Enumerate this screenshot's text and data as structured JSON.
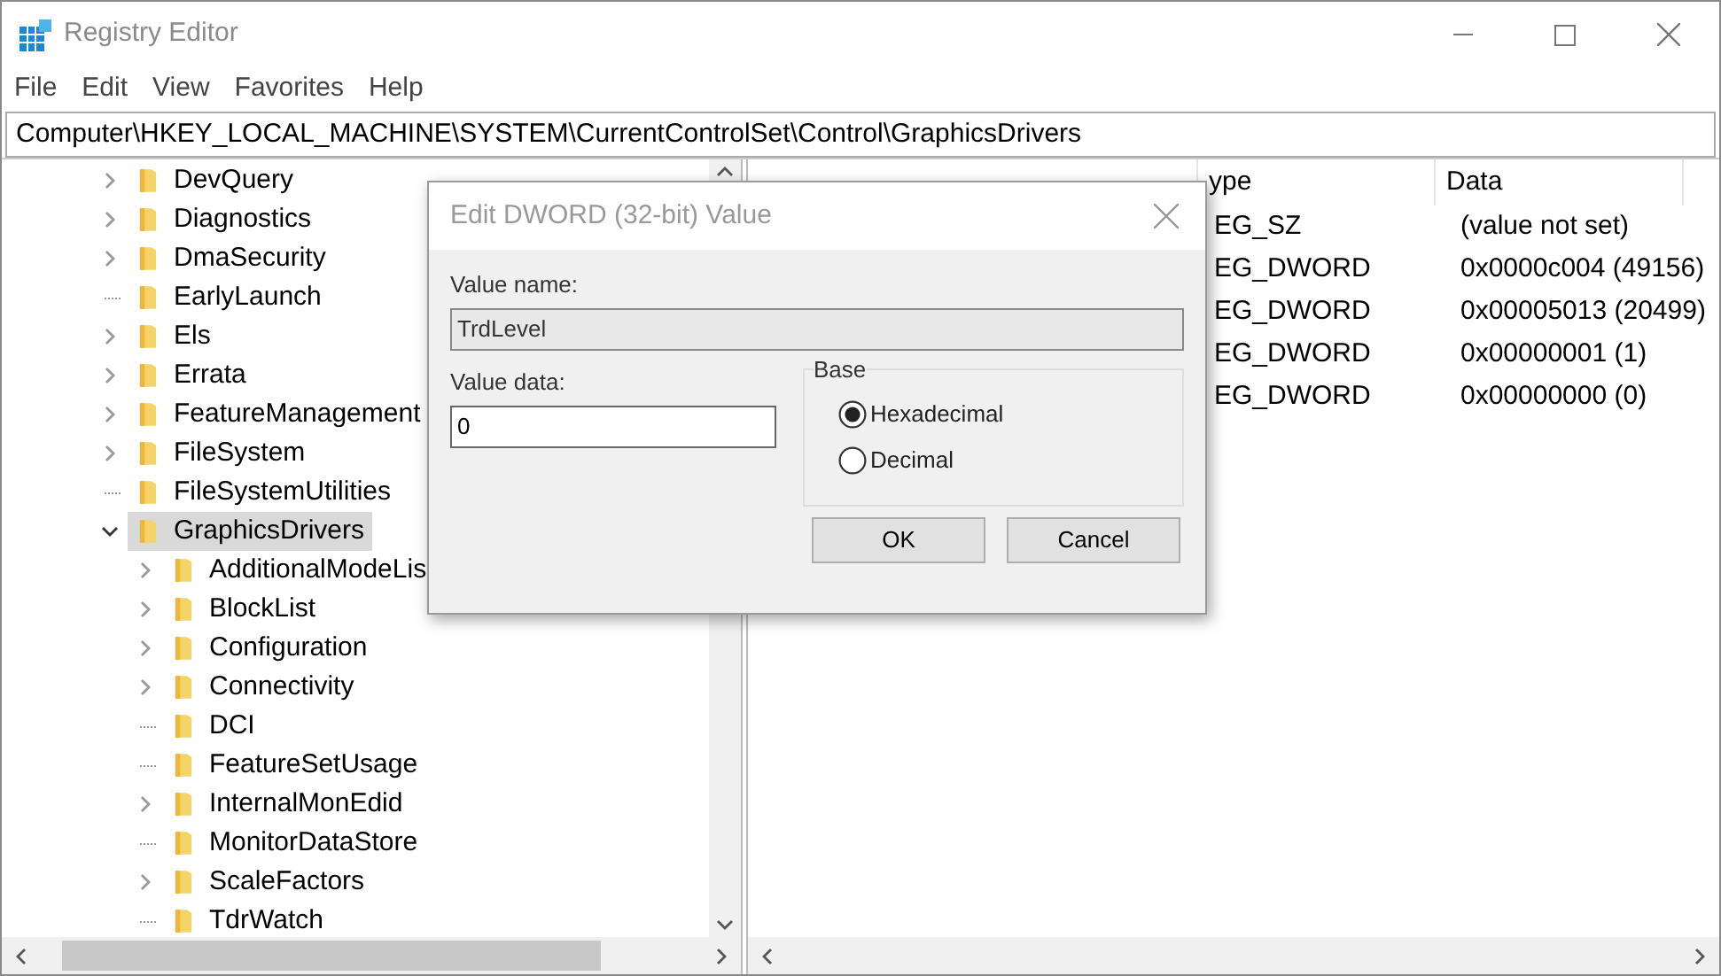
{
  "window": {
    "title": "Registry Editor"
  },
  "menu": [
    "File",
    "Edit",
    "View",
    "Favorites",
    "Help"
  ],
  "address": "Computer\\HKEY_LOCAL_MACHINE\\SYSTEM\\CurrentControlSet\\Control\\GraphicsDrivers",
  "tree": [
    {
      "label": "DevQuery",
      "kind": "collapsed",
      "selected": false
    },
    {
      "label": "Diagnostics",
      "kind": "collapsed",
      "selected": false
    },
    {
      "label": "DmaSecurity",
      "kind": "collapsed",
      "selected": false
    },
    {
      "label": "EarlyLaunch",
      "kind": "leaf",
      "selected": false
    },
    {
      "label": "Els",
      "kind": "collapsed",
      "selected": false
    },
    {
      "label": "Errata",
      "kind": "collapsed",
      "selected": false
    },
    {
      "label": "FeatureManagement",
      "kind": "collapsed",
      "selected": false
    },
    {
      "label": "FileSystem",
      "kind": "collapsed",
      "selected": false
    },
    {
      "label": "FileSystemUtilities",
      "kind": "leaf",
      "selected": false
    },
    {
      "label": "GraphicsDrivers",
      "kind": "expanded",
      "selected": true,
      "children": [
        {
          "label": "AdditionalModeLis",
          "kind": "collapsed",
          "selected": false
        },
        {
          "label": "BlockList",
          "kind": "collapsed",
          "selected": false
        },
        {
          "label": "Configuration",
          "kind": "collapsed",
          "selected": false
        },
        {
          "label": "Connectivity",
          "kind": "collapsed",
          "selected": false
        },
        {
          "label": "DCI",
          "kind": "leaf",
          "selected": false
        },
        {
          "label": "FeatureSetUsage",
          "kind": "leaf",
          "selected": false
        },
        {
          "label": "InternalMonEdid",
          "kind": "collapsed",
          "selected": false
        },
        {
          "label": "MonitorDataStore",
          "kind": "leaf",
          "selected": false
        },
        {
          "label": "ScaleFactors",
          "kind": "collapsed",
          "selected": false
        },
        {
          "label": "TdrWatch",
          "kind": "leaf",
          "selected": false
        }
      ]
    }
  ],
  "values": {
    "columns": [
      "ype",
      "Data"
    ],
    "rows": [
      {
        "type": "EG_SZ",
        "data": "(value not set)"
      },
      {
        "type": "EG_DWORD",
        "data": "0x0000c004 (49156)"
      },
      {
        "type": "EG_DWORD",
        "data": "0x00005013 (20499)"
      },
      {
        "type": "EG_DWORD",
        "data": "0x00000001 (1)"
      },
      {
        "type": "EG_DWORD",
        "data": "0x00000000 (0)"
      }
    ]
  },
  "dialog": {
    "title": "Edit DWORD (32-bit) Value",
    "value_name_label": "Value name:",
    "value_name": "TrdLevel",
    "value_data_label": "Value data:",
    "value_data": "0",
    "base_label": "Base",
    "bases": [
      {
        "label": "Hexadecimal",
        "selected": true
      },
      {
        "label": "Decimal",
        "selected": false
      }
    ],
    "buttons": [
      "OK",
      "Cancel"
    ]
  }
}
